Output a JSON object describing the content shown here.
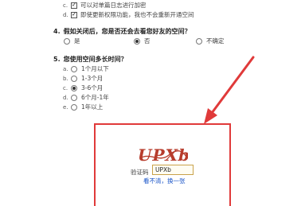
{
  "question3": {
    "options": [
      {
        "letter": "c.",
        "label": "可以对单篇日志进行加密",
        "checked": true
      },
      {
        "letter": "d.",
        "label": "即使更新权限功能，我也不会重新开通空间",
        "checked": true
      }
    ]
  },
  "question4": {
    "number": "4.",
    "text": "假如关闭后，您是否还会去看您好友的空间？",
    "options": [
      {
        "label": "是",
        "selected": false
      },
      {
        "label": "否",
        "selected": true
      },
      {
        "label": "不确定",
        "selected": false
      }
    ]
  },
  "question5": {
    "number": "5.",
    "text": "您使用空间多长时间？",
    "options": [
      {
        "letter": "a.",
        "label": "1个月以下",
        "selected": false
      },
      {
        "letter": "b.",
        "label": "1-3个月",
        "selected": false
      },
      {
        "letter": "c.",
        "label": "3-6个月",
        "selected": true
      },
      {
        "letter": "d.",
        "label": "6个月-1年",
        "selected": false
      },
      {
        "letter": "e.",
        "label": "1年以上",
        "selected": false
      }
    ]
  },
  "captcha": {
    "image_text": "UPXb",
    "label": "验证码",
    "input_value": "UPXb",
    "refresh_link": "看不清，换一张"
  },
  "colors": {
    "highlight_frame": "#e03a3a",
    "link": "#1a55c8"
  }
}
